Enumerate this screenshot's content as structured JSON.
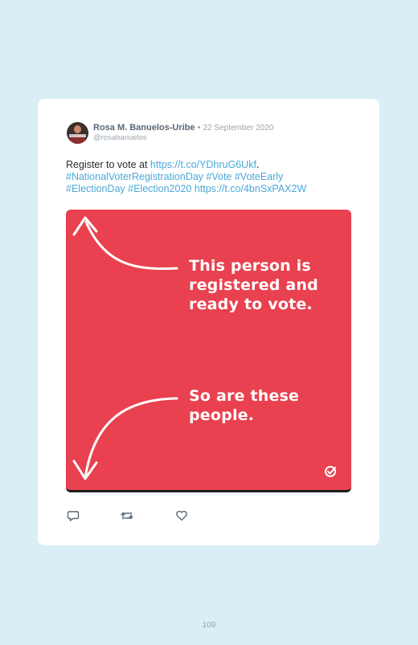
{
  "tweet": {
    "author_name": "Rosa M. Banuelos-Uribe",
    "separator": "•",
    "date": "22 September 2020",
    "handle": "@rosabanuelos",
    "text_prefix": "Register to vote at ",
    "link1": "https://t.co/YDhruG6Ukf",
    "text_after_link1": ".",
    "hashtags_line1": "#NationalVoterRegistrationDay #Vote #VoteEarly",
    "hashtags_line2": "#ElectionDay #Election2020 ",
    "link2": "https://t.co/4bnSxPAX2W",
    "avatar_badge": "ROSEMARY"
  },
  "media": {
    "message_top": "This person is\nregistered and\nready to vote.",
    "message_bottom": "So are these\npeople.",
    "background_color": "#e9414f",
    "brand_icon": "check-circle-icon"
  },
  "actions": {
    "reply_icon": "reply-icon",
    "retweet_icon": "retweet-icon",
    "like_icon": "heart-icon"
  },
  "page": {
    "number": "109"
  }
}
